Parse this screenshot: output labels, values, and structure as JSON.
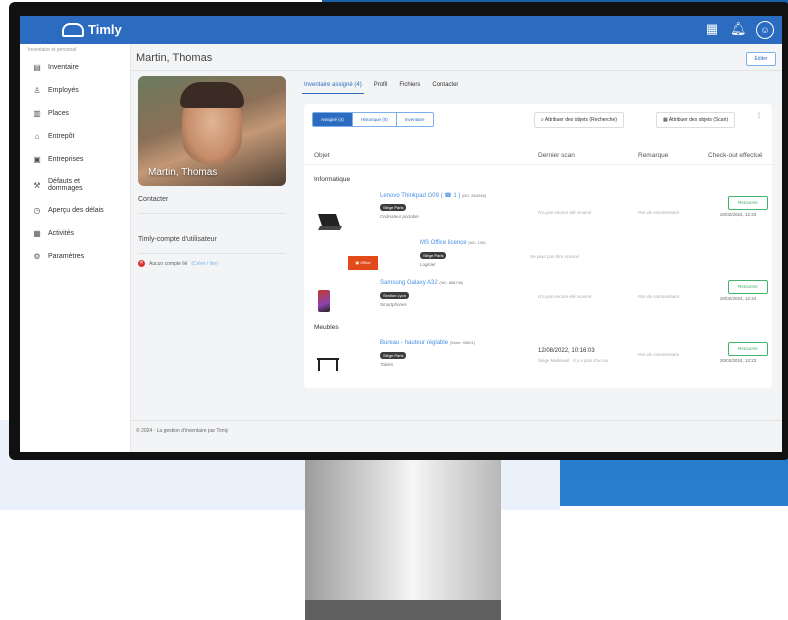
{
  "app": {
    "name": "Timly"
  },
  "sidebar": {
    "caption": "Inventaire et personal",
    "items": [
      {
        "label": "Inventaire",
        "icon": "inventory-icon"
      },
      {
        "label": "Employés",
        "icon": "person-icon"
      },
      {
        "label": "Places",
        "icon": "building-icon"
      },
      {
        "label": "Entrepôt",
        "icon": "warehouse-icon"
      },
      {
        "label": "Entreprises",
        "icon": "company-icon"
      },
      {
        "label": "Défauts et dommages",
        "icon": "wrench-icon"
      },
      {
        "label": "Aperçu des délais",
        "icon": "clock-icon"
      },
      {
        "label": "Activités",
        "icon": "calendar-icon"
      },
      {
        "label": "Paramètres",
        "icon": "gear-icon"
      }
    ]
  },
  "page": {
    "title": "Martin, Thomas",
    "edit_label": "Éditer"
  },
  "profile": {
    "name": "Martin, Thomas",
    "contact_label": "Contacter",
    "account_label": "Timly-compte d'utilisateur",
    "account_status": "Aucun compte lié",
    "account_link": "(Créer / lier)"
  },
  "tabs": [
    {
      "label": "Inventaire assigné (4)",
      "active": true
    },
    {
      "label": "Profil",
      "active": false
    },
    {
      "label": "Fichiers",
      "active": false
    },
    {
      "label": "Contacter",
      "active": false
    }
  ],
  "segments": [
    {
      "label": "Assigné (4)",
      "on": true
    },
    {
      "label": "Historique (0)",
      "on": false
    },
    {
      "label": "Inventaire",
      "on": false
    }
  ],
  "actions": {
    "attribute_search": "Attribuer des objets (Recherche)",
    "attribute_scan": "Attribuer des objets (Scan)"
  },
  "table": {
    "headers": {
      "object": "Objet",
      "last_scan": "Dernier scan",
      "remark": "Remarque",
      "checkout": "Check-out effectué"
    },
    "groups": [
      {
        "name": "Informatique",
        "rows": [
          {
            "title": "Lenovo Thinkpad G09 ( ☎ 1 )",
            "ref": "(NC: 894348)",
            "badge": "Siège Paris",
            "subtitle": "Ordinateur portable",
            "last_scan": "N'a pas encore été scanné",
            "remark": "Pas de commentaire",
            "return_label": "Retourner",
            "date": "20/02/2024, 12:23",
            "thumb": "laptop"
          },
          {
            "title": "MS Office licence",
            "ref": "(NC: 100)",
            "badge": "Siège Paris",
            "subtitle": "Logiciel",
            "last_scan": "Ne peut pas être scanné",
            "remark": "",
            "return_label": "",
            "date": "",
            "thumb": "office"
          },
          {
            "title": "Samsung Galaxy A32",
            "ref": "(NC: 888746)",
            "badge": "Section Lyon",
            "subtitle": "Smartphones",
            "last_scan": "N'a pas encore été scanné",
            "remark": "Pas de commentaire",
            "return_label": "Retourner",
            "date": "20/02/2024, 12:24",
            "thumb": "phone"
          }
        ]
      },
      {
        "name": "Meubles",
        "rows": [
          {
            "title": "Bureau - hauteur réglable",
            "ref": "(Serie: 95521)",
            "badge": "Siège Paris",
            "subtitle": "Tables",
            "last_scan": "12/08/2022, 10:16:03",
            "last_scan_sub": "Siège Mailewail · Il y a plus d'un an",
            "remark": "Pas de commentaire",
            "return_label": "Retourner",
            "date": "20/02/2024, 12:23",
            "thumb": "desk"
          }
        ]
      }
    ]
  },
  "footer": {
    "text": "© 2024 · La gestion d'inventaire par Timly"
  },
  "colors": {
    "brand": "#2b6cc0",
    "success": "#44b36b",
    "danger": "#d9342b"
  }
}
